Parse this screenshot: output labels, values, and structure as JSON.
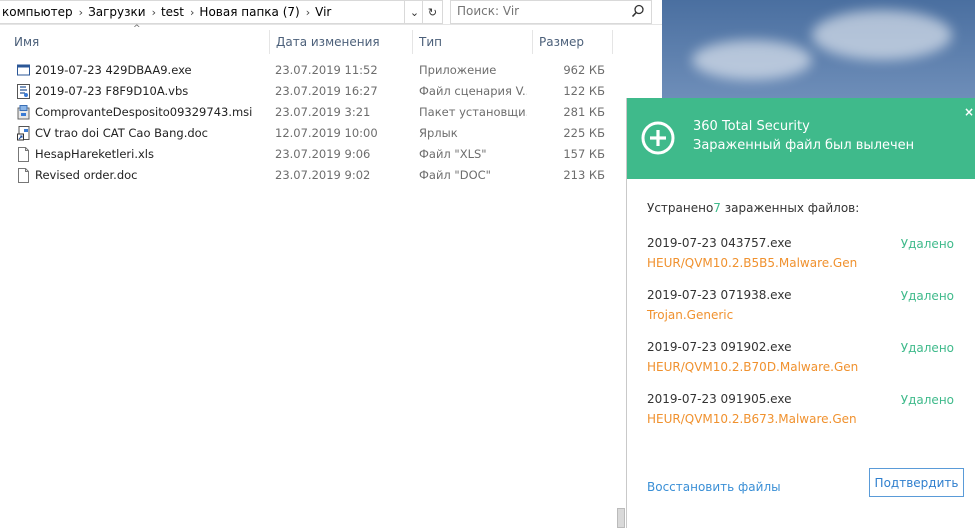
{
  "explorer": {
    "breadcrumb": [
      "компьютер",
      "Загрузки",
      "test",
      "Новая папка (7)",
      "Vir"
    ],
    "search": {
      "placeholder": "Поиск: Vir"
    },
    "columns": {
      "name": "Имя",
      "date": "Дата изменения",
      "type": "Тип",
      "size": "Размер"
    },
    "files": [
      {
        "name": "2019-07-23 429DBAA9.exe",
        "date": "23.07.2019 11:52",
        "type": "Приложение",
        "size": "962 КБ",
        "icon": "exe-icon"
      },
      {
        "name": "2019-07-23 F8F9D10A.vbs",
        "date": "23.07.2019 16:27",
        "type": "Файл сценария V...",
        "size": "122 КБ",
        "icon": "script-icon"
      },
      {
        "name": "ComprovanteDesposito09329743.msi",
        "date": "23.07.2019 3:21",
        "type": "Пакет установщи...",
        "size": "281 КБ",
        "icon": "msi-icon"
      },
      {
        "name": "CV trao doi CAT Cao Bang.doc",
        "date": "12.07.2019 10:00",
        "type": "Ярлык",
        "size": "225 КБ",
        "icon": "shortcut-icon"
      },
      {
        "name": "HesapHareketleri.xls",
        "date": "23.07.2019 9:06",
        "type": "Файл \"XLS\"",
        "size": "157 КБ",
        "icon": "document-icon"
      },
      {
        "name": "Revised order.doc",
        "date": "23.07.2019 9:02",
        "type": "Файл \"DOC\"",
        "size": "213 КБ",
        "icon": "document-icon"
      }
    ]
  },
  "popup": {
    "title": "360 Total Security",
    "subtitle": "Зараженный файл был вылечен",
    "summary_prefix": "Устранено",
    "summary_count": "7",
    "summary_suffix": " зараженных файлов:",
    "threats": [
      {
        "file": "2019-07-23 043757.exe",
        "name": "HEUR/QVM10.2.B5B5.Malware.Gen",
        "status": "Удалено"
      },
      {
        "file": "2019-07-23 071938.exe",
        "name": "Trojan.Generic",
        "status": "Удалено"
      },
      {
        "file": "2019-07-23 091902.exe",
        "name": "HEUR/QVM10.2.B70D.Malware.Gen",
        "status": "Удалено"
      },
      {
        "file": "2019-07-23 091905.exe",
        "name": "HEUR/QVM10.2.B673.Malware.Gen",
        "status": "Удалено"
      }
    ],
    "restore_link": "Восстановить файлы",
    "confirm_button": "Подтвердить"
  },
  "colors": {
    "accent": "#3fba8b",
    "threat": "#f0912e",
    "link": "#3a8fd6"
  }
}
